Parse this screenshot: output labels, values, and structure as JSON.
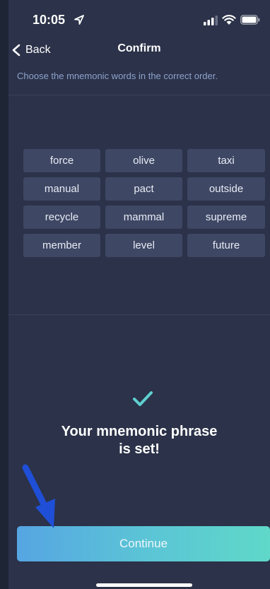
{
  "status_bar": {
    "time": "10:05"
  },
  "nav": {
    "back_label": "Back",
    "title": "Confirm"
  },
  "instruction": "Choose the mnemonic words in the correct order.",
  "words": [
    "force",
    "olive",
    "taxi",
    "manual",
    "pact",
    "outside",
    "recycle",
    "mammal",
    "supreme",
    "member",
    "level",
    "future"
  ],
  "success": {
    "line1": "Your mnemonic phrase",
    "line2": "is set!"
  },
  "continue_label": "Continue",
  "colors": {
    "background": "#2b3249",
    "chip": "#3e4764",
    "accent_check": "#5fd0d0",
    "button_gradient_start": "#56a5e2",
    "button_gradient_end": "#5fd8c8",
    "annotation_arrow": "#1f4fd6"
  },
  "icons": [
    "location-arrow-icon",
    "signal-icon",
    "wifi-icon",
    "battery-icon",
    "chevron-left-icon",
    "checkmark-icon"
  ]
}
